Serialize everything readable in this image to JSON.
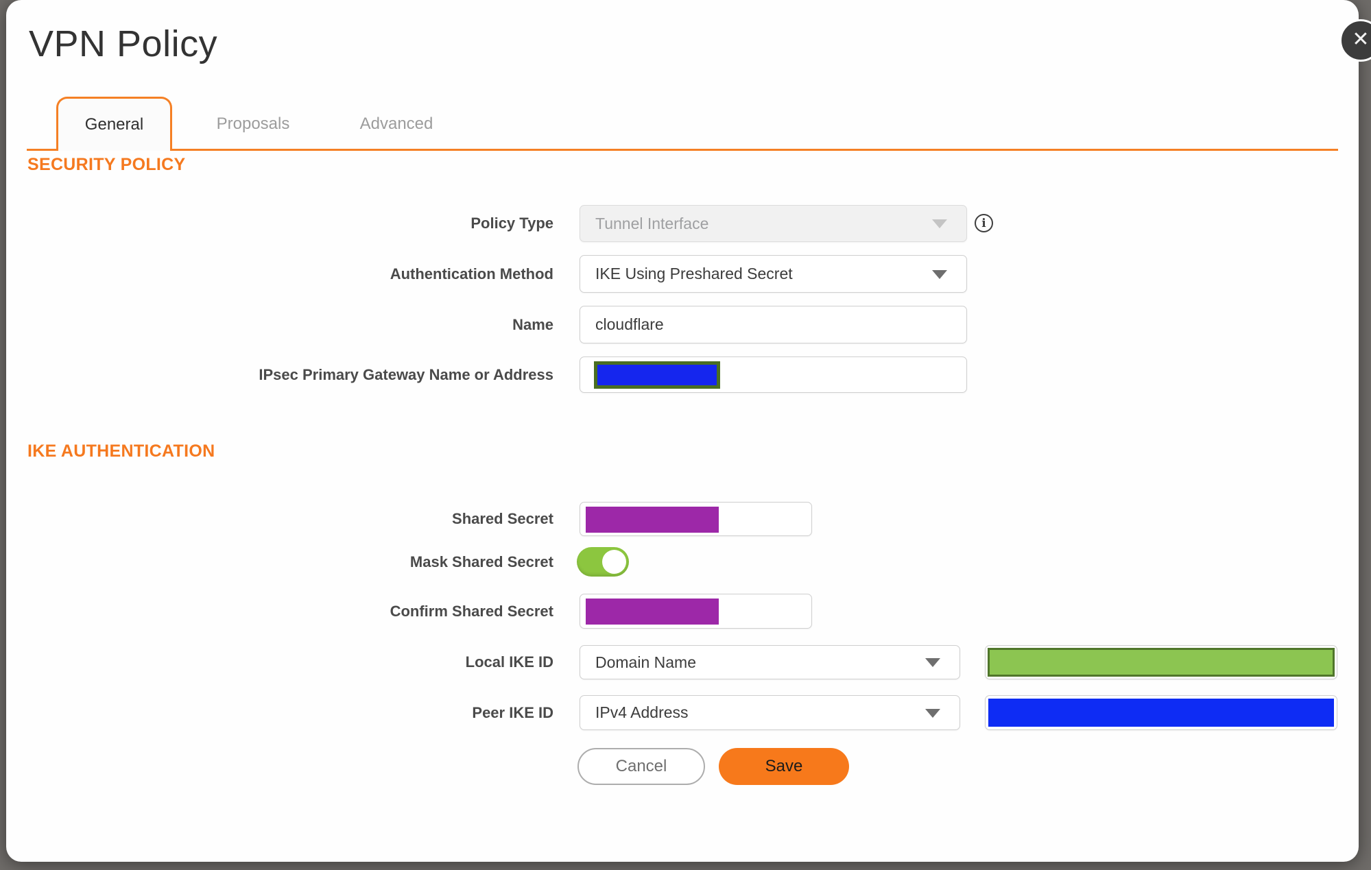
{
  "dialog": {
    "title": "VPN Policy",
    "close_label": "✕"
  },
  "tabs": [
    {
      "label": "General",
      "active": true
    },
    {
      "label": "Proposals",
      "active": false
    },
    {
      "label": "Advanced",
      "active": false
    }
  ],
  "sections": {
    "security_policy": "SECURITY POLICY",
    "ike_authentication": "IKE AUTHENTICATION"
  },
  "fields": {
    "policy_type": {
      "label": "Policy Type",
      "value": "Tunnel Interface",
      "disabled": true
    },
    "auth_method": {
      "label": "Authentication Method",
      "value": "IKE Using Preshared Secret"
    },
    "name": {
      "label": "Name",
      "value": "cloudflare"
    },
    "gateway": {
      "label": "IPsec Primary Gateway Name or Address",
      "value": "",
      "redacted": true
    },
    "shared_secret": {
      "label": "Shared Secret",
      "value": "",
      "redacted": true
    },
    "mask_shared_secret": {
      "label": "Mask Shared Secret",
      "toggle_on": true
    },
    "confirm_shared_secret": {
      "label": "Confirm Shared Secret",
      "value": "",
      "redacted": true
    },
    "local_ike_id": {
      "label": "Local IKE ID",
      "type_value": "Domain Name",
      "id_value": "",
      "redacted": true
    },
    "peer_ike_id": {
      "label": "Peer IKE ID",
      "type_value": "IPv4 Address",
      "id_value": "",
      "redacted": true
    }
  },
  "icons": {
    "info": "i",
    "close": "✕",
    "dropdown": "caret-down"
  },
  "buttons": {
    "cancel": "Cancel",
    "save": "Save"
  },
  "colors": {
    "accent_orange": "#f58025",
    "save_orange": "#f7791b",
    "toggle_green": "#8cc63f",
    "redaction_purple": "#9d28a8",
    "redaction_blue": "#0e2cf4",
    "redaction_green_fill": "#8cc551",
    "redaction_green_border": "#50762b",
    "redaction_olive_border": "#4a6e22",
    "backdrop_gray": "#6f6c69"
  }
}
